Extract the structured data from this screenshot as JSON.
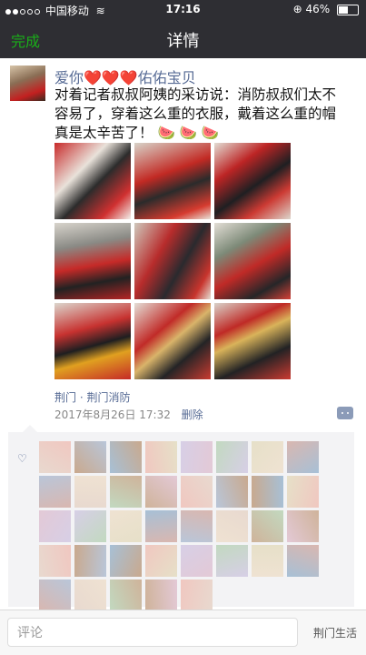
{
  "status_bar": {
    "carrier": "中国移动",
    "time": "17:16",
    "battery_text": "46%",
    "battery_fraction": 0.46,
    "icons": [
      "signal-dots-icon",
      "wifi-icon",
      "orientation-lock-icon",
      "battery-icon"
    ]
  },
  "navbar": {
    "done_label": "完成",
    "title": "详情"
  },
  "post": {
    "author_name": "爱你❤️❤️❤️佑佑宝贝",
    "content_text": "对着记者叔叔阿姨的采访说：消防叔叔们太不容易了，穿着这么重的衣服，戴着这么重的帽真是太辛苦了！",
    "content_emoji": "🍉 🍉 🍉",
    "photos_count": 9,
    "location": "荆门 · 荆门消防",
    "timestamp": "2017年8月26日 17:32",
    "delete_label": "删除"
  },
  "likes": {
    "count": 37
  },
  "bottom_bar": {
    "comment_placeholder": "评论",
    "watermark": "荆门生活"
  },
  "colors": {
    "accent_green": "#1aad19",
    "link_blue": "#576b95",
    "dark_bar": "#2e2e33"
  }
}
